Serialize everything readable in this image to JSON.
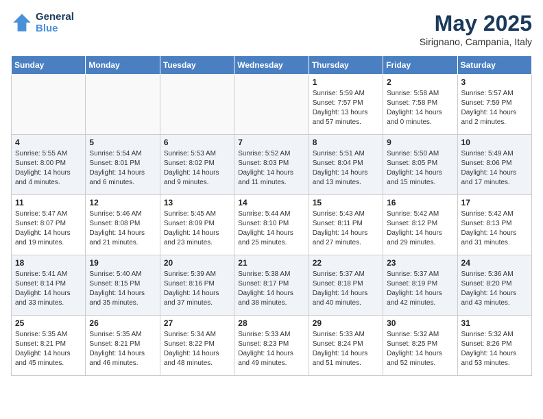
{
  "logo": {
    "line1": "General",
    "line2": "Blue"
  },
  "title": "May 2025",
  "subtitle": "Sirignano, Campania, Italy",
  "weekdays": [
    "Sunday",
    "Monday",
    "Tuesday",
    "Wednesday",
    "Thursday",
    "Friday",
    "Saturday"
  ],
  "weeks": [
    [
      {
        "day": "",
        "info": ""
      },
      {
        "day": "",
        "info": ""
      },
      {
        "day": "",
        "info": ""
      },
      {
        "day": "",
        "info": ""
      },
      {
        "day": "1",
        "info": "Sunrise: 5:59 AM\nSunset: 7:57 PM\nDaylight: 13 hours\nand 57 minutes."
      },
      {
        "day": "2",
        "info": "Sunrise: 5:58 AM\nSunset: 7:58 PM\nDaylight: 14 hours\nand 0 minutes."
      },
      {
        "day": "3",
        "info": "Sunrise: 5:57 AM\nSunset: 7:59 PM\nDaylight: 14 hours\nand 2 minutes."
      }
    ],
    [
      {
        "day": "4",
        "info": "Sunrise: 5:55 AM\nSunset: 8:00 PM\nDaylight: 14 hours\nand 4 minutes."
      },
      {
        "day": "5",
        "info": "Sunrise: 5:54 AM\nSunset: 8:01 PM\nDaylight: 14 hours\nand 6 minutes."
      },
      {
        "day": "6",
        "info": "Sunrise: 5:53 AM\nSunset: 8:02 PM\nDaylight: 14 hours\nand 9 minutes."
      },
      {
        "day": "7",
        "info": "Sunrise: 5:52 AM\nSunset: 8:03 PM\nDaylight: 14 hours\nand 11 minutes."
      },
      {
        "day": "8",
        "info": "Sunrise: 5:51 AM\nSunset: 8:04 PM\nDaylight: 14 hours\nand 13 minutes."
      },
      {
        "day": "9",
        "info": "Sunrise: 5:50 AM\nSunset: 8:05 PM\nDaylight: 14 hours\nand 15 minutes."
      },
      {
        "day": "10",
        "info": "Sunrise: 5:49 AM\nSunset: 8:06 PM\nDaylight: 14 hours\nand 17 minutes."
      }
    ],
    [
      {
        "day": "11",
        "info": "Sunrise: 5:47 AM\nSunset: 8:07 PM\nDaylight: 14 hours\nand 19 minutes."
      },
      {
        "day": "12",
        "info": "Sunrise: 5:46 AM\nSunset: 8:08 PM\nDaylight: 14 hours\nand 21 minutes."
      },
      {
        "day": "13",
        "info": "Sunrise: 5:45 AM\nSunset: 8:09 PM\nDaylight: 14 hours\nand 23 minutes."
      },
      {
        "day": "14",
        "info": "Sunrise: 5:44 AM\nSunset: 8:10 PM\nDaylight: 14 hours\nand 25 minutes."
      },
      {
        "day": "15",
        "info": "Sunrise: 5:43 AM\nSunset: 8:11 PM\nDaylight: 14 hours\nand 27 minutes."
      },
      {
        "day": "16",
        "info": "Sunrise: 5:42 AM\nSunset: 8:12 PM\nDaylight: 14 hours\nand 29 minutes."
      },
      {
        "day": "17",
        "info": "Sunrise: 5:42 AM\nSunset: 8:13 PM\nDaylight: 14 hours\nand 31 minutes."
      }
    ],
    [
      {
        "day": "18",
        "info": "Sunrise: 5:41 AM\nSunset: 8:14 PM\nDaylight: 14 hours\nand 33 minutes."
      },
      {
        "day": "19",
        "info": "Sunrise: 5:40 AM\nSunset: 8:15 PM\nDaylight: 14 hours\nand 35 minutes."
      },
      {
        "day": "20",
        "info": "Sunrise: 5:39 AM\nSunset: 8:16 PM\nDaylight: 14 hours\nand 37 minutes."
      },
      {
        "day": "21",
        "info": "Sunrise: 5:38 AM\nSunset: 8:17 PM\nDaylight: 14 hours\nand 38 minutes."
      },
      {
        "day": "22",
        "info": "Sunrise: 5:37 AM\nSunset: 8:18 PM\nDaylight: 14 hours\nand 40 minutes."
      },
      {
        "day": "23",
        "info": "Sunrise: 5:37 AM\nSunset: 8:19 PM\nDaylight: 14 hours\nand 42 minutes."
      },
      {
        "day": "24",
        "info": "Sunrise: 5:36 AM\nSunset: 8:20 PM\nDaylight: 14 hours\nand 43 minutes."
      }
    ],
    [
      {
        "day": "25",
        "info": "Sunrise: 5:35 AM\nSunset: 8:21 PM\nDaylight: 14 hours\nand 45 minutes."
      },
      {
        "day": "26",
        "info": "Sunrise: 5:35 AM\nSunset: 8:21 PM\nDaylight: 14 hours\nand 46 minutes."
      },
      {
        "day": "27",
        "info": "Sunrise: 5:34 AM\nSunset: 8:22 PM\nDaylight: 14 hours\nand 48 minutes."
      },
      {
        "day": "28",
        "info": "Sunrise: 5:33 AM\nSunset: 8:23 PM\nDaylight: 14 hours\nand 49 minutes."
      },
      {
        "day": "29",
        "info": "Sunrise: 5:33 AM\nSunset: 8:24 PM\nDaylight: 14 hours\nand 51 minutes."
      },
      {
        "day": "30",
        "info": "Sunrise: 5:32 AM\nSunset: 8:25 PM\nDaylight: 14 hours\nand 52 minutes."
      },
      {
        "day": "31",
        "info": "Sunrise: 5:32 AM\nSunset: 8:26 PM\nDaylight: 14 hours\nand 53 minutes."
      }
    ]
  ]
}
